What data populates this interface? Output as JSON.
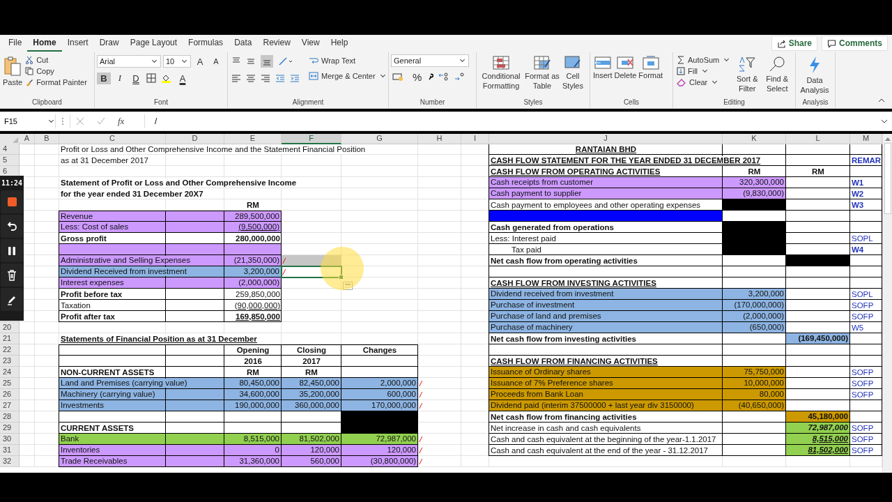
{
  "ribbon": {
    "tabs": [
      {
        "label": "File",
        "selected": false
      },
      {
        "label": "Home",
        "selected": true
      },
      {
        "label": "Insert",
        "selected": false
      },
      {
        "label": "Draw",
        "selected": false
      },
      {
        "label": "Page Layout",
        "selected": false
      },
      {
        "label": "Formulas",
        "selected": false
      },
      {
        "label": "Data",
        "selected": false
      },
      {
        "label": "Review",
        "selected": false
      },
      {
        "label": "View",
        "selected": false
      },
      {
        "label": "Help",
        "selected": false
      }
    ],
    "share": "Share",
    "comments": "Comments",
    "clipboard": {
      "paste": "Paste",
      "cut": "Cut",
      "copy": "Copy",
      "format_painter": "Format Painter",
      "label": "Clipboard"
    },
    "font": {
      "family": "Arial",
      "size": "10",
      "grow": "A",
      "shrink": "A",
      "bold": "B",
      "italic": "I",
      "underline": "D",
      "font_color": "A",
      "bold_on": true,
      "italic_on": false,
      "underline_on": false,
      "label": "Font"
    },
    "alignment": {
      "wrap": "Wrap Text",
      "merge": "Merge & Center",
      "bottom_on": true,
      "label": "Alignment"
    },
    "number": {
      "format": "General",
      "percent": "%",
      "label": "Number"
    },
    "styles": {
      "conditional": "Conditional Formatting",
      "table": "Format as Table",
      "cell": "Cell Styles",
      "label": "Styles"
    },
    "cells": {
      "insert": "Insert",
      "delete": "Delete",
      "format": "Format",
      "label": "Cells"
    },
    "editing": {
      "autosum": "AutoSum",
      "fill": "Fill",
      "clear": "Clear",
      "sort": "Sort & Filter",
      "find": "Find & Select",
      "label": "Editing"
    },
    "analysis": {
      "data_analysis": "Data Analysis",
      "label": "Analysis"
    }
  },
  "formula_bar": {
    "name_box": "F15",
    "fx": "fx",
    "formula": "/"
  },
  "recorder": {
    "time": "11:24"
  },
  "sheet": {
    "columns": [
      {
        "letter": "A",
        "selected": false
      },
      {
        "letter": "B",
        "selected": false
      },
      {
        "letter": "C",
        "selected": false
      },
      {
        "letter": "D",
        "selected": false
      },
      {
        "letter": "E",
        "selected": false
      },
      {
        "letter": "F",
        "selected": true
      },
      {
        "letter": "G",
        "selected": false
      },
      {
        "letter": "H",
        "selected": false
      },
      {
        "letter": "I",
        "selected": false
      },
      {
        "letter": "J",
        "selected": false
      },
      {
        "letter": "K",
        "selected": false
      },
      {
        "letter": "L",
        "selected": false
      },
      {
        "letter": "M",
        "selected": false
      }
    ],
    "rows": [
      {
        "number": "4",
        "cells": [
          "",
          "",
          {
            "text": "Profit or Loss and Other Comprehensive Income and the Statement Financial Position",
            "kind": "caption"
          },
          "",
          "",
          "",
          "",
          "",
          "",
          {
            "text": "RANTAIAN BHD",
            "kind": "heading",
            "bold": true,
            "underline": true
          },
          {
            "kind": "blank"
          },
          {
            "kind": "blank"
          },
          {
            "kind": "blank"
          }
        ]
      },
      {
        "number": "5",
        "cells": [
          "",
          "",
          {
            "text": "as at 31  December 2017",
            "kind": "caption"
          },
          "",
          "",
          "",
          "",
          "",
          "",
          {
            "text": "CASH FLOW STATEMENT FOR THE YEAR ENDED 31 DECEMBER 2017",
            "kind": "label",
            "bold": true,
            "underline": true
          },
          {
            "kind": "blank"
          },
          {
            "kind": "blank"
          },
          {
            "text": "REMAR",
            "kind": "remark",
            "bold": true
          }
        ]
      },
      {
        "number": "6",
        "cells": [
          "",
          "",
          "",
          "",
          "",
          "",
          "",
          "",
          "",
          {
            "text": "CASH FLOW FROM OPERATING ACTIVITIES",
            "kind": "label",
            "bold": true,
            "underline": true
          },
          {
            "text": "RM",
            "kind": "heading",
            "bold": true
          },
          {
            "text": "RM",
            "kind": "heading",
            "bold": true
          },
          {
            "kind": "blank"
          }
        ]
      },
      {
        "cells": [
          "",
          "",
          {
            "text": "Statement of Profit or Loss and Other Comprehensive Income",
            "kind": "caption",
            "bold": true
          },
          "",
          "",
          "",
          "",
          "",
          "",
          {
            "text": "Cash receipts from customer",
            "kind": "label",
            "color": "#cc99ff"
          },
          {
            "text": "320,300,000",
            "kind": "number",
            "color": "#cc99ff"
          },
          {
            "kind": "blank"
          },
          {
            "text": "W1",
            "kind": "remark",
            "bold": true
          }
        ]
      },
      {
        "cells": [
          "",
          "",
          {
            "text": "for the year ended 31 December 20X7",
            "kind": "caption",
            "bold": true
          },
          "",
          "",
          "",
          "",
          "",
          "",
          {
            "text": "Cash payment to supplier",
            "kind": "label",
            "color": "#cc99ff"
          },
          {
            "text": "(9,830,000)",
            "kind": "number",
            "color": "#cc99ff"
          },
          {
            "kind": "blank"
          },
          {
            "text": "W2",
            "kind": "remark",
            "bold": true
          }
        ]
      },
      {
        "cells": [
          "",
          "",
          "",
          "",
          {
            "text": "RM",
            "kind": "caption_heading",
            "bold": true
          },
          "",
          "",
          "",
          "",
          {
            "text": "Cash payment to employees and other operating expenses",
            "kind": "label"
          },
          {
            "kind": "blank",
            "color": "#000000"
          },
          {
            "kind": "blank"
          },
          {
            "text": "W3",
            "kind": "remark",
            "bold": true
          }
        ]
      },
      {
        "cells": [
          "",
          "",
          {
            "text": "Revenue",
            "kind": "label",
            "color": "#cc99ff"
          },
          {
            "kind": "blank",
            "color": "#cc99ff"
          },
          {
            "text": "289,500,000",
            "kind": "number",
            "color": "#cc99ff"
          },
          "",
          "",
          "",
          "",
          {
            "kind": "blank",
            "color": "#0000ff"
          },
          {
            "kind": "blank"
          },
          {
            "kind": "blank"
          },
          {
            "kind": "blank"
          }
        ]
      },
      {
        "cells": [
          "",
          "",
          {
            "text": "Less: Cost of sales",
            "kind": "label",
            "color": "#cc99ff"
          },
          {
            "kind": "blank",
            "color": "#cc99ff"
          },
          {
            "text": "(9,500,000)",
            "kind": "number",
            "color": "#cc99ff",
            "underline": true
          },
          "",
          "",
          "",
          "",
          {
            "text": "Cash generated from operations",
            "kind": "label",
            "bold": true
          },
          {
            "kind": "blank",
            "color": "#000000"
          },
          {
            "kind": "blank"
          },
          {
            "kind": "blank"
          }
        ]
      },
      {
        "cells": [
          "",
          "",
          {
            "text": "Gross profit",
            "kind": "label",
            "bold": true
          },
          {
            "kind": "blank"
          },
          {
            "text": "280,000,000",
            "kind": "number",
            "bold": true
          },
          "",
          "",
          "",
          "",
          {
            "text": "Less: Interest paid",
            "kind": "label"
          },
          {
            "kind": "blank",
            "color": "#000000"
          },
          {
            "kind": "blank"
          },
          {
            "text": "SOPL",
            "kind": "remark"
          }
        ]
      },
      {
        "cells": [
          "",
          "",
          {
            "kind": "blank",
            "color": "#cc99ff"
          },
          {
            "kind": "blank",
            "color": "#cc99ff"
          },
          {
            "kind": "blank",
            "color": "#cc99ff"
          },
          "",
          "",
          "",
          "",
          {
            "text": "Tax paid",
            "kind": "sublabel"
          },
          {
            "kind": "blank",
            "color": "#000000"
          },
          {
            "kind": "blank"
          },
          {
            "text": "W4",
            "kind": "remark",
            "bold": true
          }
        ]
      },
      {
        "cells": [
          "",
          "",
          {
            "text": "Administrative and Selling Expenses",
            "kind": "label",
            "color": "#cc99ff"
          },
          {
            "kind": "blank",
            "color": "#cc99ff"
          },
          {
            "text": "(21,350,000)",
            "kind": "number",
            "color": "#cc99ff"
          },
          {
            "text": "/",
            "kind": "mark",
            "color": "#c6c6c6"
          },
          "",
          "",
          "",
          {
            "text": "Net cash flow from operating  activities",
            "kind": "label",
            "bold": true
          },
          {
            "kind": "blank"
          },
          {
            "kind": "blank",
            "color": "#000000"
          },
          {
            "kind": "blank"
          }
        ]
      },
      {
        "cells": [
          "",
          "",
          {
            "text": "Dividend Received from investment",
            "kind": "label",
            "color": "#8db4e2"
          },
          {
            "kind": "blank",
            "color": "#8db4e2"
          },
          {
            "text": "3,200,000",
            "kind": "number",
            "color": "#8db4e2"
          },
          {
            "text": "/",
            "kind": "mark",
            "selected": true
          },
          "",
          "",
          "",
          {
            "kind": "blank"
          },
          {
            "kind": "blank"
          },
          {
            "kind": "blank"
          },
          {
            "kind": "blank"
          }
        ]
      },
      {
        "cells": [
          "",
          "",
          {
            "text": "Interest expenses",
            "kind": "label",
            "color": "#cc99ff"
          },
          {
            "kind": "blank",
            "color": "#cc99ff"
          },
          {
            "text": "(2,000,000)",
            "kind": "number",
            "color": "#cc99ff"
          },
          "",
          "",
          "",
          "",
          {
            "text": "CASH FLOW FROM INVESTING ACTIVITIES",
            "kind": "label",
            "bold": true,
            "underline": true
          },
          {
            "kind": "blank"
          },
          {
            "kind": "blank"
          },
          {
            "kind": "blank"
          }
        ]
      },
      {
        "cells": [
          "",
          "",
          {
            "text": "Profit before tax",
            "kind": "label",
            "bold": true
          },
          {
            "kind": "blank"
          },
          {
            "text": "259,850,000",
            "kind": "number"
          },
          "",
          "",
          "",
          "",
          {
            "text": "Dividend received from investment",
            "kind": "label",
            "color": "#8db4e2"
          },
          {
            "text": "3,200,000",
            "kind": "number",
            "color": "#8db4e2"
          },
          {
            "kind": "blank"
          },
          {
            "text": "SOPL",
            "kind": "remark"
          }
        ]
      },
      {
        "cells": [
          "",
          "",
          {
            "text": "Taxation",
            "kind": "label"
          },
          {
            "kind": "blank"
          },
          {
            "text": "(90,000,000)",
            "kind": "number",
            "underline": true
          },
          "",
          "",
          "",
          "",
          {
            "text": "Purchase of investment",
            "kind": "label",
            "color": "#8db4e2"
          },
          {
            "text": "(170,000,000)",
            "kind": "number",
            "color": "#8db4e2"
          },
          {
            "kind": "blank"
          },
          {
            "text": "SOFP",
            "kind": "remark"
          }
        ]
      },
      {
        "cells": [
          "",
          "",
          {
            "text": "Profit after tax",
            "kind": "label",
            "bold": true
          },
          {
            "kind": "blank"
          },
          {
            "text": "169,850,000",
            "kind": "number",
            "bold": true,
            "underline": true
          },
          "",
          "",
          "",
          "",
          {
            "text": "Purchase of land and premises",
            "kind": "label",
            "color": "#8db4e2"
          },
          {
            "text": "(2,000,000)",
            "kind": "number",
            "color": "#8db4e2"
          },
          {
            "kind": "blank"
          },
          {
            "text": "SOFP",
            "kind": "remark"
          }
        ]
      },
      {
        "number": "20",
        "cells": [
          "",
          "",
          "",
          "",
          "",
          "",
          "",
          "",
          "",
          {
            "text": "Purchase of machinery",
            "kind": "label",
            "color": "#8db4e2"
          },
          {
            "text": "(650,000)",
            "kind": "number",
            "color": "#8db4e2"
          },
          {
            "kind": "blank"
          },
          {
            "text": "W5",
            "kind": "remark"
          }
        ]
      },
      {
        "number": "21",
        "cells": [
          "",
          "",
          {
            "text": "Statements of Financial Position as at 31 December",
            "kind": "caption",
            "bold": true,
            "underline": true
          },
          "",
          "",
          "",
          "",
          "",
          "",
          {
            "text": "Net cash flow from investing activities",
            "kind": "label",
            "bold": true
          },
          {
            "kind": "blank"
          },
          {
            "text": "(169,450,000)",
            "kind": "number",
            "bold": true,
            "color": "#8db4e2"
          },
          {
            "kind": "blank"
          }
        ]
      },
      {
        "number": "22",
        "cells": [
          "",
          "",
          {
            "kind": "blank"
          },
          {
            "kind": "blank"
          },
          {
            "text": "Opening",
            "kind": "heading",
            "bold": true
          },
          {
            "text": "Closing",
            "kind": "heading",
            "bold": true
          },
          {
            "text": "Changes",
            "kind": "heading",
            "bold": true
          },
          "",
          "",
          {
            "kind": "blank"
          },
          {
            "kind": "blank"
          },
          {
            "kind": "blank"
          },
          {
            "kind": "blank"
          }
        ]
      },
      {
        "number": "23",
        "cells": [
          "",
          "",
          {
            "kind": "blank"
          },
          {
            "kind": "blank"
          },
          {
            "text": "2016",
            "kind": "heading",
            "bold": true
          },
          {
            "text": "2017",
            "kind": "heading",
            "bold": true
          },
          {
            "kind": "blank"
          },
          "",
          "",
          {
            "text": "CASH FLOW FROM FINANCING ACTIVITIES",
            "kind": "label",
            "bold": true,
            "underline": true
          },
          {
            "kind": "blank"
          },
          {
            "kind": "blank"
          },
          {
            "kind": "blank"
          }
        ]
      },
      {
        "number": "24",
        "cells": [
          "",
          "",
          {
            "text": "NON-CURRENT ASSETS",
            "kind": "label",
            "bold": true
          },
          {
            "kind": "blank"
          },
          {
            "text": "RM",
            "kind": "heading",
            "bold": true
          },
          {
            "text": "RM",
            "kind": "heading",
            "bold": true
          },
          {
            "kind": "blank"
          },
          "",
          "",
          {
            "text": "Issuance of Ordinary shares",
            "kind": "label",
            "color": "#cc9900"
          },
          {
            "text": "75,750,000",
            "kind": "number",
            "color": "#cc9900"
          },
          {
            "kind": "blank"
          },
          {
            "text": "SOFP",
            "kind": "remark"
          }
        ]
      },
      {
        "number": "25",
        "cells": [
          "",
          "",
          {
            "text": "Land and Premises (carrying value)",
            "kind": "label",
            "color": "#8db4e2"
          },
          {
            "kind": "blank",
            "color": "#8db4e2"
          },
          {
            "text": "80,450,000",
            "kind": "number",
            "color": "#8db4e2"
          },
          {
            "text": "82,450,000",
            "kind": "number",
            "color": "#8db4e2"
          },
          {
            "text": "2,000,000",
            "kind": "number",
            "color": "#8db4e2"
          },
          {
            "text": "/",
            "kind": "mark"
          },
          "",
          {
            "text": "Issuance of 7% Preference shares",
            "kind": "label",
            "color": "#cc9900"
          },
          {
            "text": "10,000,000",
            "kind": "number",
            "color": "#cc9900"
          },
          {
            "kind": "blank"
          },
          {
            "text": "SOFP",
            "kind": "remark"
          }
        ]
      },
      {
        "number": "26",
        "cells": [
          "",
          "",
          {
            "text": "Machinery (carrying value)",
            "kind": "label",
            "color": "#8db4e2"
          },
          {
            "kind": "blank",
            "color": "#8db4e2"
          },
          {
            "text": "34,600,000",
            "kind": "number",
            "color": "#8db4e2"
          },
          {
            "text": "35,200,000",
            "kind": "number",
            "color": "#8db4e2"
          },
          {
            "text": "600,000",
            "kind": "number",
            "color": "#8db4e2"
          },
          {
            "text": "/",
            "kind": "mark"
          },
          "",
          {
            "text": "Proceeds from Bank Loan",
            "kind": "label",
            "color": "#cc9900"
          },
          {
            "text": "80,000",
            "kind": "number",
            "color": "#cc9900"
          },
          {
            "kind": "blank"
          },
          {
            "text": "SOFP",
            "kind": "remark"
          }
        ]
      },
      {
        "number": "27",
        "cells": [
          "",
          "",
          {
            "text": "Investments",
            "kind": "label",
            "color": "#8db4e2"
          },
          {
            "kind": "blank",
            "color": "#8db4e2"
          },
          {
            "text": "190,000,000",
            "kind": "number",
            "color": "#8db4e2"
          },
          {
            "text": "360,000,000",
            "kind": "number",
            "color": "#8db4e2"
          },
          {
            "text": "170,000,000",
            "kind": "number",
            "color": "#8db4e2"
          },
          {
            "text": "/",
            "kind": "mark"
          },
          "",
          {
            "text": "Dividend paid (interim 37500000 + last year div 3150000)",
            "kind": "label",
            "color": "#cc9900"
          },
          {
            "text": "(40,650,000)",
            "kind": "number",
            "color": "#cc9900"
          },
          {
            "kind": "blank"
          },
          {
            "kind": "blank"
          }
        ]
      },
      {
        "number": "28",
        "cells": [
          "",
          "",
          {
            "kind": "blank"
          },
          {
            "kind": "blank"
          },
          {
            "kind": "blank"
          },
          {
            "kind": "blank"
          },
          {
            "kind": "blank",
            "color": "#000000"
          },
          "",
          "",
          {
            "text": "Net cash flow from financing activities",
            "kind": "label",
            "bold": true
          },
          {
            "kind": "blank"
          },
          {
            "text": "45,180,000",
            "kind": "number",
            "bold": true,
            "color": "#cc9900"
          },
          {
            "kind": "blank"
          }
        ]
      },
      {
        "number": "29",
        "cells": [
          "",
          "",
          {
            "text": "CURRENT ASSETS",
            "kind": "label",
            "bold": true
          },
          {
            "kind": "blank"
          },
          {
            "kind": "blank"
          },
          {
            "kind": "blank"
          },
          {
            "kind": "blank",
            "color": "#000000"
          },
          "",
          "",
          {
            "text": "Net increase in cash and cash equivalents",
            "kind": "label"
          },
          {
            "kind": "blank"
          },
          {
            "text": "72,987,000",
            "kind": "number",
            "bold": true,
            "italic": true,
            "color": "#92d050"
          },
          {
            "text": "SOFP",
            "kind": "remark"
          }
        ]
      },
      {
        "number": "30",
        "cells": [
          "",
          "",
          {
            "text": "Bank",
            "kind": "label",
            "color": "#92d050"
          },
          {
            "kind": "blank",
            "color": "#92d050"
          },
          {
            "text": "8,515,000",
            "kind": "number",
            "color": "#92d050"
          },
          {
            "text": "81,502,000",
            "kind": "number",
            "color": "#92d050"
          },
          {
            "text": "72,987,000",
            "kind": "number",
            "color": "#92d050"
          },
          {
            "text": "/",
            "kind": "mark"
          },
          "",
          {
            "text": "Cash and cash equivalent at the beginning of the year-1.1.2017",
            "kind": "label"
          },
          {
            "kind": "blank"
          },
          {
            "text": "8,515,000",
            "kind": "number",
            "bold": true,
            "italic": true,
            "underline": true,
            "color": "#92d050"
          },
          {
            "text": "SOFP",
            "kind": "remark"
          }
        ]
      },
      {
        "number": "31",
        "cells": [
          "",
          "",
          {
            "text": "Inventories",
            "kind": "label",
            "color": "#cc99ff"
          },
          {
            "kind": "blank",
            "color": "#cc99ff"
          },
          {
            "text": "0",
            "kind": "number",
            "color": "#cc99ff"
          },
          {
            "text": "120,000",
            "kind": "number",
            "color": "#cc99ff"
          },
          {
            "text": "120,000",
            "kind": "number",
            "color": "#cc99ff"
          },
          {
            "text": "/",
            "kind": "mark"
          },
          "",
          {
            "text": "Cash and cash equivalent at the end of the year - 31.12.2017",
            "kind": "label"
          },
          {
            "kind": "blank"
          },
          {
            "text": "81,502,000",
            "kind": "number",
            "bold": true,
            "italic": true,
            "underline": true,
            "color": "#92d050"
          },
          {
            "text": "SOFP",
            "kind": "remark"
          }
        ]
      },
      {
        "number": "32",
        "cells": [
          "",
          "",
          {
            "text": "Trade Receivables",
            "kind": "label",
            "color": "#cc99ff"
          },
          {
            "kind": "blank",
            "color": "#cc99ff"
          },
          {
            "text": "31,360,000",
            "kind": "number",
            "color": "#cc99ff"
          },
          {
            "text": "560,000",
            "kind": "number",
            "color": "#cc99ff"
          },
          {
            "text": "(30,800,000)",
            "kind": "number",
            "color": "#cc99ff"
          },
          {
            "text": "/",
            "kind": "mark"
          }
        ]
      }
    ]
  }
}
